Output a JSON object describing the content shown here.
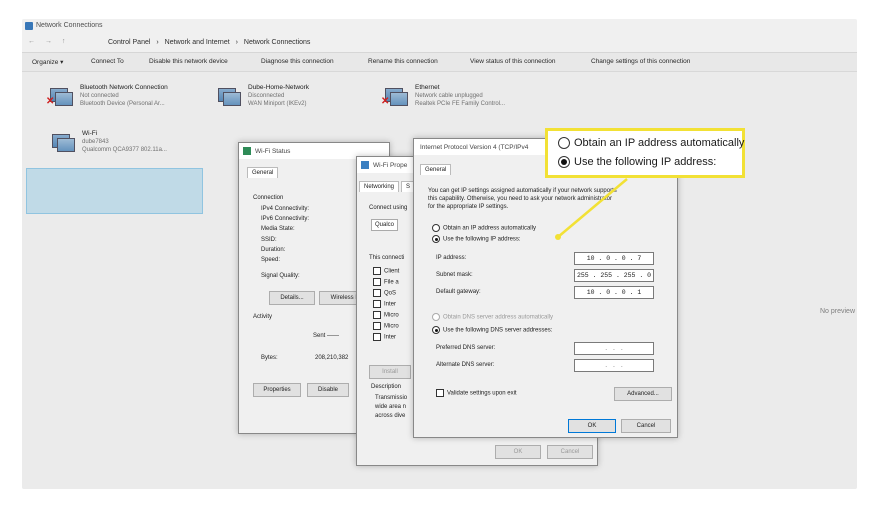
{
  "window": {
    "title": "Network Connections"
  },
  "address": {
    "nav": "← → ↑",
    "breadcrumbs": [
      "Control Panel",
      "›",
      "Network and Internet",
      "›",
      "Network Connections"
    ]
  },
  "toolbar": {
    "organize": "Organize ▾",
    "connect_to": "Connect To",
    "disable": "Disable this network device",
    "diagnose": "Diagnose this connection",
    "rename": "Rename this connection",
    "view_status": "View status of this connection",
    "change_settings": "Change settings of this connection"
  },
  "adapters": [
    {
      "name": "Bluetooth Network Connection",
      "status": "Not connected",
      "device": "Bluetooth Device (Personal Ar..."
    },
    {
      "name": "Dube-Home-Network",
      "status": "Disconnected",
      "device": "WAN Miniport (IKEv2)"
    },
    {
      "name": "Ethernet",
      "status": "Network cable unplugged",
      "device": "Realtek PCIe FE Family Control..."
    },
    {
      "name": "Wi-Fi",
      "status": "dube7843",
      "device": "Qualcomm QCA9377 802.11a..."
    }
  ],
  "preview": "No preview",
  "wifi_status": {
    "title": "Wi-Fi Status",
    "tab": "General",
    "connection_label": "Connection",
    "fields": [
      "IPv4 Connectivity:",
      "IPv6 Connectivity:",
      "Media State:",
      "SSID:",
      "Duration:",
      "Speed:"
    ],
    "signal": "Signal Quality:",
    "details_btn": "Details...",
    "wireless_btn": "Wireless P",
    "activity": "Activity",
    "sent": "Sent ——",
    "bytes_label": "Bytes:",
    "bytes_value": "208,210,382",
    "properties_btn": "Properties",
    "disable_btn": "Disable"
  },
  "wifi_props": {
    "title": "Wi-Fi Prope",
    "tab_networking": "Networking",
    "tab_s": "S",
    "connect_using": "Connect using",
    "adapter": "Qualco",
    "this_conn": "This connecti",
    "items": [
      "Client",
      "File a",
      "QoS",
      "Inter",
      "Micro",
      "Micro",
      "Inter"
    ],
    "install": "Install",
    "description": "Description",
    "desc_text": [
      "Transmissio",
      "wide area n",
      "across dive"
    ],
    "ok": "OK",
    "cancel": "Cancel"
  },
  "ipv4": {
    "title": "Internet Protocol Version 4 (TCP/IPv4",
    "tab": "General",
    "info": [
      "You can get IP settings assigned automatically if your network supports",
      "this capability. Otherwise, you need to ask your network administrator",
      "for the appropriate IP settings."
    ],
    "obtain_auto": "Obtain an IP address automatically",
    "use_following": "Use the following IP address:",
    "ip_label": "IP address:",
    "ip_value": "10 . 0 . 0 . 7",
    "mask_label": "Subnet mask:",
    "mask_value": "255 . 255 . 255 . 0",
    "gateway_label": "Default gateway:",
    "gateway_value": "10 . 0 . 0 . 1",
    "dns_auto": "Obtain DNS server address automatically",
    "dns_use": "Use the following DNS server addresses:",
    "pref_dns": "Preferred DNS server:",
    "alt_dns": "Alternate DNS server:",
    "dns_empty": ". . .",
    "validate": "Validate settings upon exit",
    "advanced": "Advanced...",
    "ok": "OK",
    "cancel": "Cancel"
  },
  "callout": {
    "option1": "Obtain an IP address automatically",
    "option2": "Use the following IP address:"
  },
  "colors": {
    "callout_border": "#f2e135",
    "selection": "#cde8f6",
    "accent": "#0078d7"
  }
}
